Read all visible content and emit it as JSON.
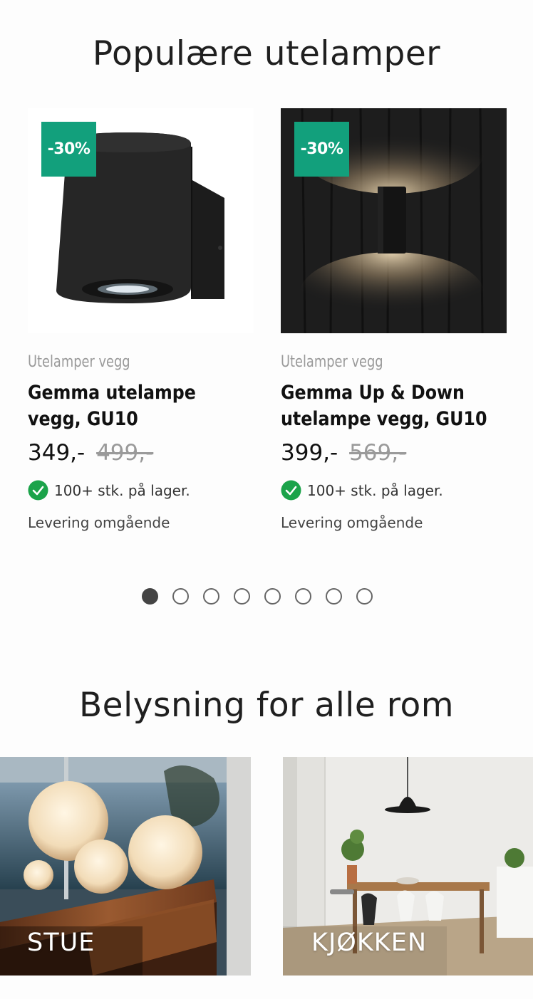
{
  "popular": {
    "title": "Populære utelamper",
    "products": [
      {
        "badge": "-30%",
        "category": "Utelamper vegg",
        "name": "Gemma utelampe vegg, GU10",
        "price": "349,-",
        "old_price": "499,-",
        "stock": "100+ stk. på lager.",
        "delivery": "Levering omgående"
      },
      {
        "badge": "-30%",
        "category": "Utelamper vegg",
        "name": "Gemma Up & Down utelampe vegg, GU10",
        "price": "399,-",
        "old_price": "569,-",
        "stock": "100+ stk. på lager.",
        "delivery": "Levering omgående"
      }
    ],
    "carousel": {
      "page_count": 8,
      "active_index": 0
    }
  },
  "rooms": {
    "title": "Belysning for alle rom",
    "items": [
      {
        "label": "STUE"
      },
      {
        "label": "KJØKKEN"
      }
    ]
  },
  "colors": {
    "badge": "#12a07c",
    "stock_check": "#1ba34a"
  }
}
